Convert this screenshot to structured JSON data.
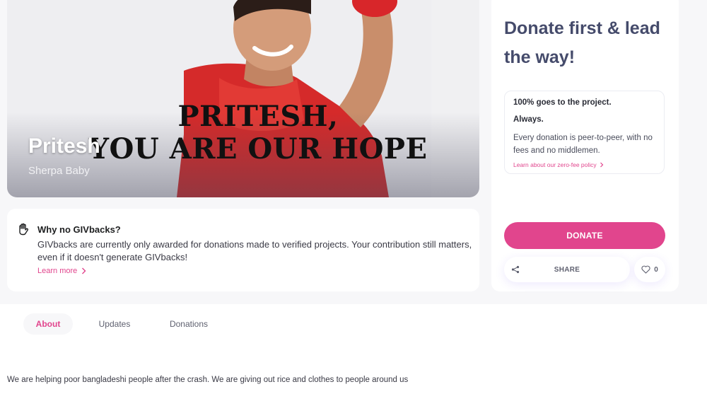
{
  "hero": {
    "title": "Pritesh",
    "subtitle": "Sherpa Baby",
    "banner_line1": "PRITESH,",
    "banner_line2": "YOU ARE OUR HOPE"
  },
  "givbacks_notice": {
    "title": "Why no GIVbacks?",
    "body": "GIVbacks are currently only awarded for donations made to verified projects. Your contribution still matters, even if it doesn't generate GIVbacks!",
    "link": "Learn more",
    "icon": "hand-stop-icon"
  },
  "donate_panel": {
    "heading": "Donate first & lead the way!",
    "promise_line1": "100% goes to the project.",
    "promise_line2": "Always.",
    "promise_body": "Every donation is peer-to-peer, with no fees and no middlemen.",
    "promise_link": "Learn about our zero-fee policy",
    "donate_label": "DONATE",
    "share_label": "SHARE",
    "like_count": "0"
  },
  "tabs": [
    {
      "label": "About",
      "active": true
    },
    {
      "label": "Updates",
      "active": false
    },
    {
      "label": "Donations",
      "active": false
    }
  ],
  "description": "We are helping poor bangladeshi people after the crash. We are giving out rice and clothes to people around us",
  "colors": {
    "accent": "#e1458d",
    "heading": "#454b6b",
    "background": "#f7f7f9"
  }
}
